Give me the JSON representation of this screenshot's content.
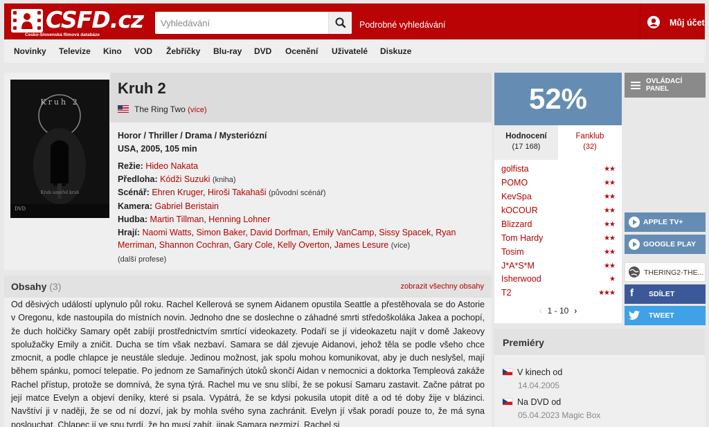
{
  "header": {
    "logo_text": "CSFD.cz",
    "logo_sub": "Česko-Slovenská filmová databáze",
    "search_placeholder": "Vyhledávání",
    "advanced_search": "Podrobné vyhledávání",
    "account_label": "Můj účet"
  },
  "nav": [
    "Novinky",
    "Televize",
    "Kino",
    "VOD",
    "Žebříčky",
    "Blu-ray",
    "DVD",
    "Ocenění",
    "Uživatelé",
    "Diskuze"
  ],
  "film": {
    "title": "Kruh 2",
    "original_title": "The Ring Two",
    "original_more": "(více)",
    "genres": "Horor / Thriller / Drama / Mysteriózní",
    "origin": "USA, 2005, 105 min",
    "poster_title": "Kruh 2",
    "poster_tagline": "Kruh uzavřel kruh",
    "poster_dvd": "DVD",
    "creators": {
      "director_label": "Režie:",
      "director": "Hideo Nakata",
      "source_label": "Předloha:",
      "source": "Kódži Suzuki",
      "source_note": "(kniha)",
      "script_label": "Scénář:",
      "script_1": "Ehren Kruger",
      "script_2": "Hiroši Takahaši",
      "script_note": "(původní scénář)",
      "camera_label": "Kamera:",
      "camera": "Gabriel Beristain",
      "music_label": "Hudba:",
      "music_1": "Martin Tillman",
      "music_2": "Henning Lohner",
      "cast_label": "Hrají:",
      "cast": [
        "Naomi Watts",
        "Simon Baker",
        "David Dorfman",
        "Emily VanCamp",
        "Sissy Spacek",
        "Ryan Merriman",
        "Shannon Cochran",
        "Gary Cole",
        "Kelly Overton",
        "James Lesure"
      ],
      "cast_more": "(více)",
      "more_professions": "(další profese)"
    }
  },
  "plots": {
    "title": "Obsahy",
    "count": "(3)",
    "show_all": "zobrazit všechny obsahy",
    "text": "Od děsivých událostí uplynulo půl roku. Rachel Kellerová se synem Aidanem opustila Seattle a přestěhovala se do Astorie v Oregonu, kde nastoupila do místních novin. Jednoho dne se doslechne o záhadné smrti středoškoláka Jakea a pochopí, že duch holčičky Samary opět zabíjí prostřednictvím smrtící videokazety. Podaří se jí videokazetu najít v domě Jakeovy spolužačky Emily a zničit. Ducha se tím však nezbaví. Samara se dál zjevuje Aidanovi, jehož těla se podle všeho chce zmocnit, a podle chlapce je neustále sleduje. Jedinou možnost, jak spolu mohou komunikovat, aby je duch neslyšel, mají během spánku, pomocí telepatie. Po jednom ze Samařiných útoků skončí Aidan v nemocnici a doktorka Templeová zakáže Rachel přístup, protože se domnívá, že syna týrá. Rachel mu ve snu slíbí, že se pokusí Samaru zastavit. Začne pátrat po její matce Evelyn a objeví deníky, které si psala. Vypátrá, že se kdysi pokusila utopit dítě a od té doby žije v blázinci. Navštíví ji v naději, že se od ní dozví, jak by mohla svého syna zachránit. Evelyn jí však poradí pouze to, že má syna poslouchat. Chlapec jí ve snu tvrdí, že ho musí zabít, jinak Samara nezmizí. Rachel si"
  },
  "rating": {
    "percent": "52%",
    "tab_ratings": "Hodnocení",
    "tab_ratings_count": "(17 168)",
    "tab_fanclub": "Fanklub",
    "tab_fanclub_count": "(32)",
    "users": [
      {
        "name": "golfista",
        "stars": "★★"
      },
      {
        "name": "POMO",
        "stars": "★★"
      },
      {
        "name": "KevSpa",
        "stars": "★★"
      },
      {
        "name": "kOCOUR",
        "stars": "★★"
      },
      {
        "name": "Blizzard",
        "stars": "★★"
      },
      {
        "name": "Tom Hardy",
        "stars": "★★"
      },
      {
        "name": "Tosim",
        "stars": "★★"
      },
      {
        "name": "J*A*S*M",
        "stars": "★★"
      },
      {
        "name": "Isherwood",
        "stars": "★"
      },
      {
        "name": "T2",
        "stars": "★★★"
      }
    ],
    "pager": "1 - 10",
    "pager_prev": "‹",
    "pager_next": "›"
  },
  "side": {
    "control_panel": "OVLÁDACÍ PANEL",
    "apple_tv": "APPLE TV+",
    "google_play": "GOOGLE PLAY",
    "website": "THERING2-THE...",
    "share": "SDÍLET",
    "tweet": "TWEET"
  },
  "premieres": {
    "title": "Premiéry",
    "items": [
      {
        "label": "V kinech od",
        "date": "14.04.2005"
      },
      {
        "label": "Na DVD od",
        "date": "05.04.2023 Magic Box"
      }
    ]
  },
  "colors": {
    "brand_red": "#ba0305",
    "rating_blue": "#658db4",
    "facebook": "#3b5998",
    "twitter": "#3fa1e6"
  },
  "icons": [
    "logo-film-reel-icon",
    "search-icon",
    "user-icon",
    "flag-us-icon",
    "star-icon",
    "menu-lines-icon",
    "play-icon",
    "globe-icon",
    "facebook-icon",
    "twitter-icon",
    "flag-cz-icon"
  ]
}
